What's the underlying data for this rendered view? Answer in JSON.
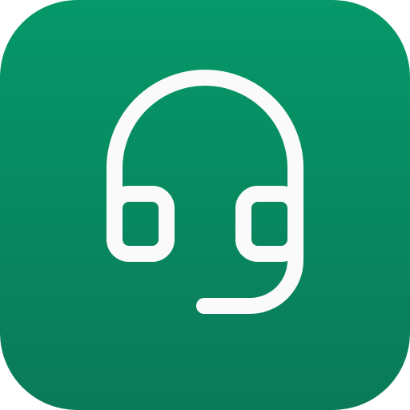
{
  "icon": {
    "name": "headset-icon",
    "colors": {
      "background_top": "#069869",
      "background_bottom": "#0A7A58",
      "glyph": "#FAFAFA"
    }
  }
}
